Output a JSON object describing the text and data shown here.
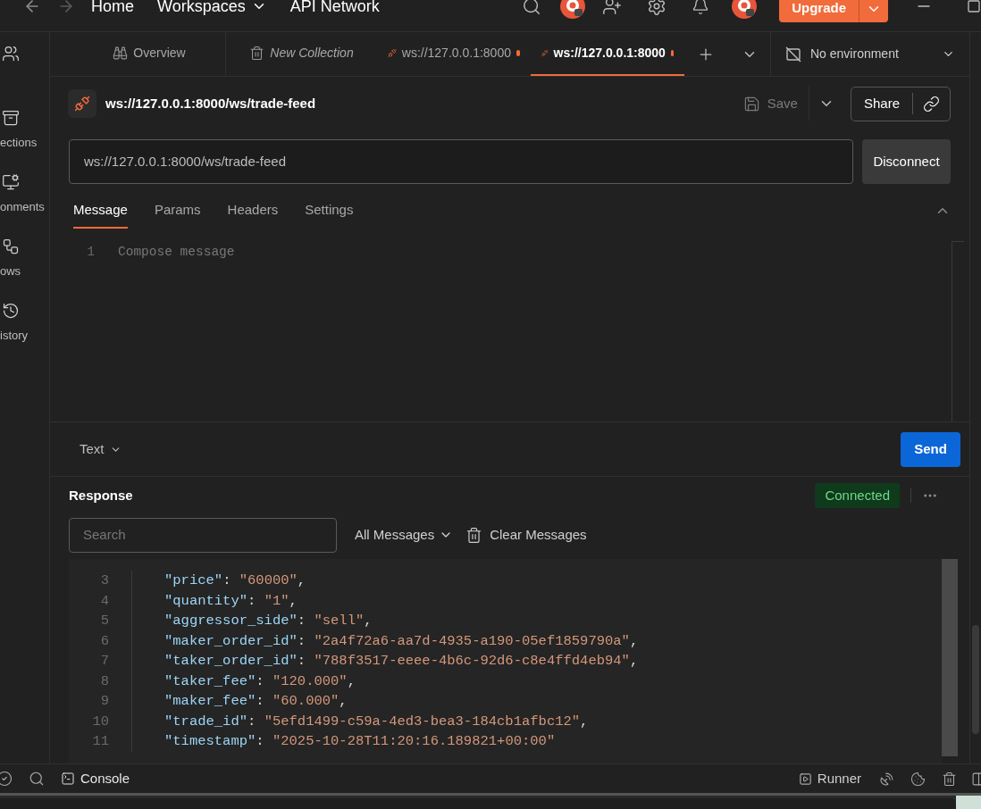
{
  "top_bar": {
    "nav": [
      {
        "label": "Home",
        "dropdown": false
      },
      {
        "label": "Workspaces",
        "dropdown": true
      },
      {
        "label": "API Network",
        "dropdown": false
      }
    ],
    "upgrade": "Upgrade"
  },
  "sidebar": {
    "items": [
      {
        "kind": "team"
      },
      {
        "kind": "collections",
        "label": "ections"
      },
      {
        "kind": "environments",
        "label": "onments"
      },
      {
        "kind": "flows",
        "label": "ows"
      },
      {
        "kind": "history",
        "label": "istory"
      }
    ]
  },
  "tabs": [
    {
      "kind": "overview",
      "label": "Overview",
      "italic": false,
      "unsaved": false,
      "selected": false
    },
    {
      "kind": "collection",
      "label": "New Collection",
      "italic": true,
      "unsaved": false,
      "selected": false
    },
    {
      "kind": "websocket",
      "label": "ws://127.0.0.1:8000",
      "italic": false,
      "unsaved": true,
      "selected": false
    },
    {
      "kind": "websocket",
      "label": "ws://127.0.0.1:8000",
      "italic": false,
      "unsaved": true,
      "selected": true
    }
  ],
  "environment": "No environment",
  "request": {
    "title": "ws://127.0.0.1:8000/ws/trade-feed",
    "save": "Save",
    "share": "Share",
    "url": "ws://127.0.0.1:8000/ws/trade-feed",
    "connect_button": "Disconnect"
  },
  "message_tabs": [
    {
      "label": "Message",
      "selected": true
    },
    {
      "label": "Params",
      "selected": false
    },
    {
      "label": "Headers",
      "selected": false
    },
    {
      "label": "Settings",
      "selected": false
    }
  ],
  "editor": {
    "line_number": "1",
    "placeholder": "Compose message"
  },
  "format": "Text",
  "send": "Send",
  "response": {
    "title": "Response",
    "status": "Connected",
    "search_placeholder": "Search",
    "filter": "All Messages",
    "clear": "Clear Messages",
    "lines": [
      {
        "kind": "pair",
        "number": "3",
        "key": "\"price\"",
        "colon": ":",
        "value": "\"60000\"",
        "comma": ","
      },
      {
        "kind": "pair",
        "number": "4",
        "key": "\"quantity\"",
        "colon": ":",
        "value": "\"1\"",
        "comma": ","
      },
      {
        "kind": "pair",
        "number": "5",
        "key": "\"aggressor_side\"",
        "colon": ":",
        "value": "\"sell\"",
        "comma": ","
      },
      {
        "kind": "pair",
        "number": "6",
        "key": "\"maker_order_id\"",
        "colon": ":",
        "value": "\"2a4f72a6-aa7d-4935-a190-05ef1859790a\"",
        "comma": ","
      },
      {
        "kind": "pair",
        "number": "7",
        "key": "\"taker_order_id\"",
        "colon": ":",
        "value": "\"788f3517-eeee-4b6c-92d6-c8e4ffd4eb94\"",
        "comma": ","
      },
      {
        "kind": "pair",
        "number": "8",
        "key": "\"taker_fee\"",
        "colon": ":",
        "value": "\"120.000\"",
        "comma": ","
      },
      {
        "kind": "pair",
        "number": "9",
        "key": "\"maker_fee\"",
        "colon": ":",
        "value": "\"60.000\"",
        "comma": ","
      },
      {
        "kind": "pair",
        "number": "10",
        "key": "\"trade_id\"",
        "colon": ":",
        "value": "\"5efd1499-c59a-4ed3-bea3-184cb1afbc12\"",
        "comma": ","
      },
      {
        "kind": "pair",
        "number": "11",
        "key": "\"timestamp\"",
        "colon": ":",
        "value": "\"2025-10-28T11:20:16.189821+00:00\""
      }
    ]
  },
  "status_bar": {
    "console": "Console",
    "runner": "Runner"
  }
}
